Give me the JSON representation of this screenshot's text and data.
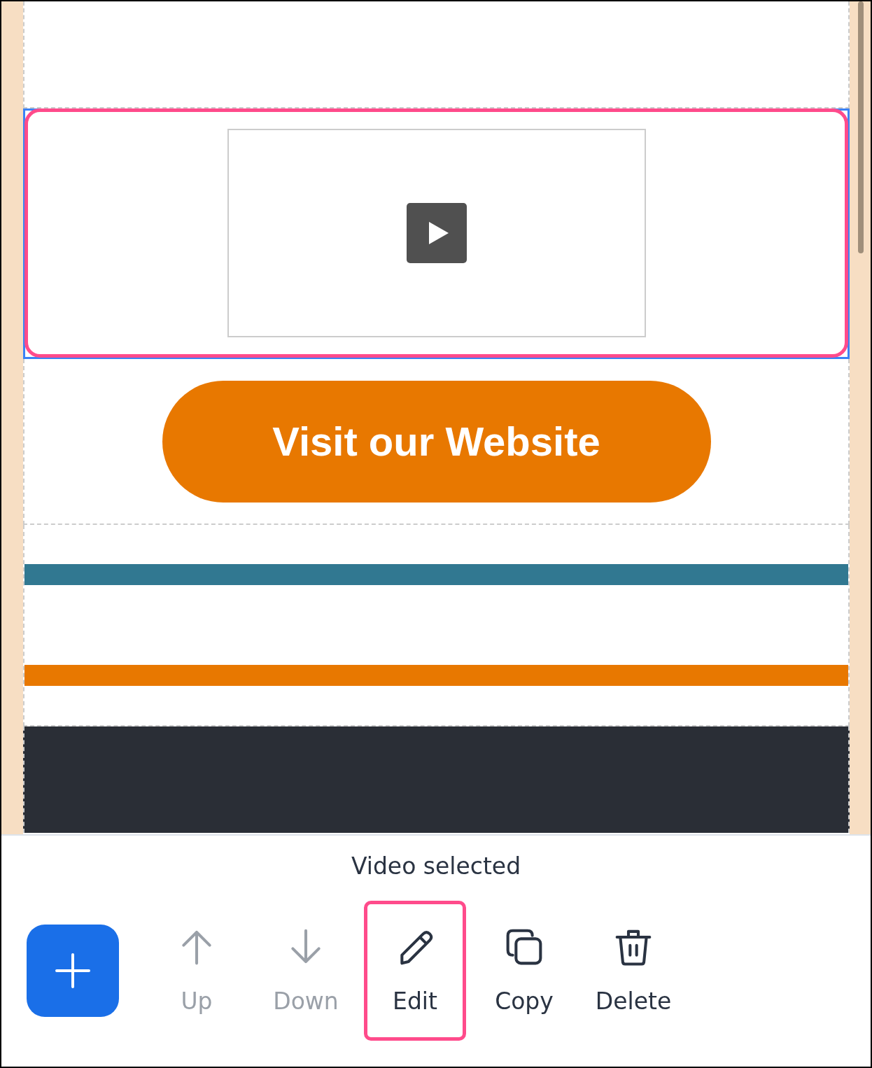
{
  "blocks": [
    {
      "kind": "spacer"
    },
    {
      "kind": "video",
      "selected": true,
      "highlighted": true
    },
    {
      "kind": "button",
      "label": "Visit our Website"
    },
    {
      "kind": "dividers",
      "bars": [
        {
          "color": "#317891"
        },
        {
          "color": "#e87800"
        }
      ]
    },
    {
      "kind": "footer"
    }
  ],
  "toolbar": {
    "status": "Video selected",
    "actions": [
      {
        "kind": "add"
      },
      {
        "kind": "up",
        "label": "Up",
        "disabled": true,
        "highlighted": false
      },
      {
        "kind": "down",
        "label": "Down",
        "disabled": true,
        "highlighted": false
      },
      {
        "kind": "edit",
        "label": "Edit",
        "disabled": false,
        "highlighted": true
      },
      {
        "kind": "copy",
        "label": "Copy",
        "disabled": false,
        "highlighted": false
      },
      {
        "kind": "delete",
        "label": "Delete",
        "disabled": false,
        "highlighted": false
      }
    ]
  }
}
